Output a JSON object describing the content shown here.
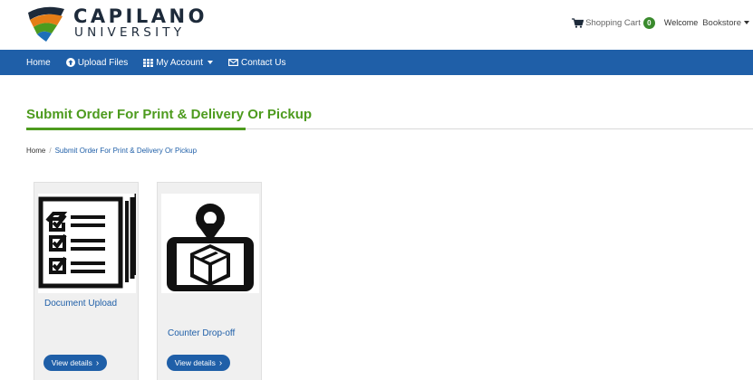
{
  "brand": {
    "name_line1": "CAPILANO",
    "name_line2": "UNIVERSITY"
  },
  "header": {
    "cart_label": "Shopping Cart",
    "cart_count": "0",
    "welcome_label": "Welcome",
    "user_name": "Bookstore"
  },
  "nav": {
    "items": [
      {
        "label": "Home",
        "icon": ""
      },
      {
        "label": "Upload Files",
        "icon": "upload-circle-icon"
      },
      {
        "label": "My Account",
        "icon": "grid-icon",
        "has_dropdown": true
      },
      {
        "label": "Contact Us",
        "icon": "envelope-icon"
      }
    ]
  },
  "page": {
    "title": "Submit Order For Print & Delivery Or Pickup"
  },
  "breadcrumb": {
    "home": "Home",
    "separator": "/",
    "current": "Submit Order For Print & Delivery Or Pickup"
  },
  "cards": [
    {
      "title": "Document Upload",
      "button_label": "View details",
      "image_icon": "checklist-document-icon"
    },
    {
      "title": "Counter Drop-off",
      "button_label": "View details",
      "image_icon": "phone-location-package-icon"
    }
  ],
  "colors": {
    "brand_blue": "#1f5fa8",
    "accent_green": "#4d9b1e",
    "badge_green": "#3a8a2d"
  }
}
